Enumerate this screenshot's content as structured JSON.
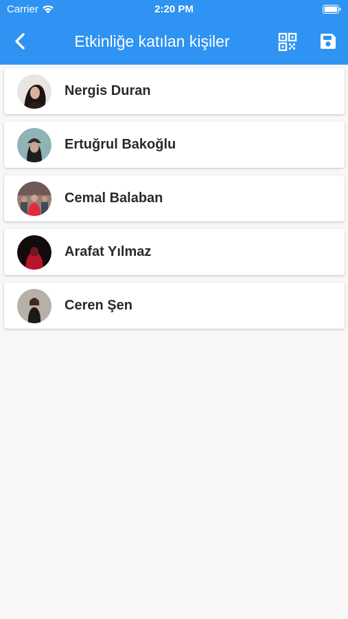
{
  "status_bar": {
    "carrier": "Carrier",
    "time": "2:20 PM"
  },
  "app_bar": {
    "title": "Etkinliğe katılan kişiler",
    "back_icon": "chevron-left-icon",
    "qr_icon": "qr-code-icon",
    "save_icon": "save-icon",
    "color": "#2e93f2"
  },
  "participants": [
    {
      "name": "Nergis Duran"
    },
    {
      "name": "Ertuğrul Bakoğlu"
    },
    {
      "name": "Cemal Balaban"
    },
    {
      "name": "Arafat Yılmaz"
    },
    {
      "name": "Ceren Şen"
    }
  ]
}
